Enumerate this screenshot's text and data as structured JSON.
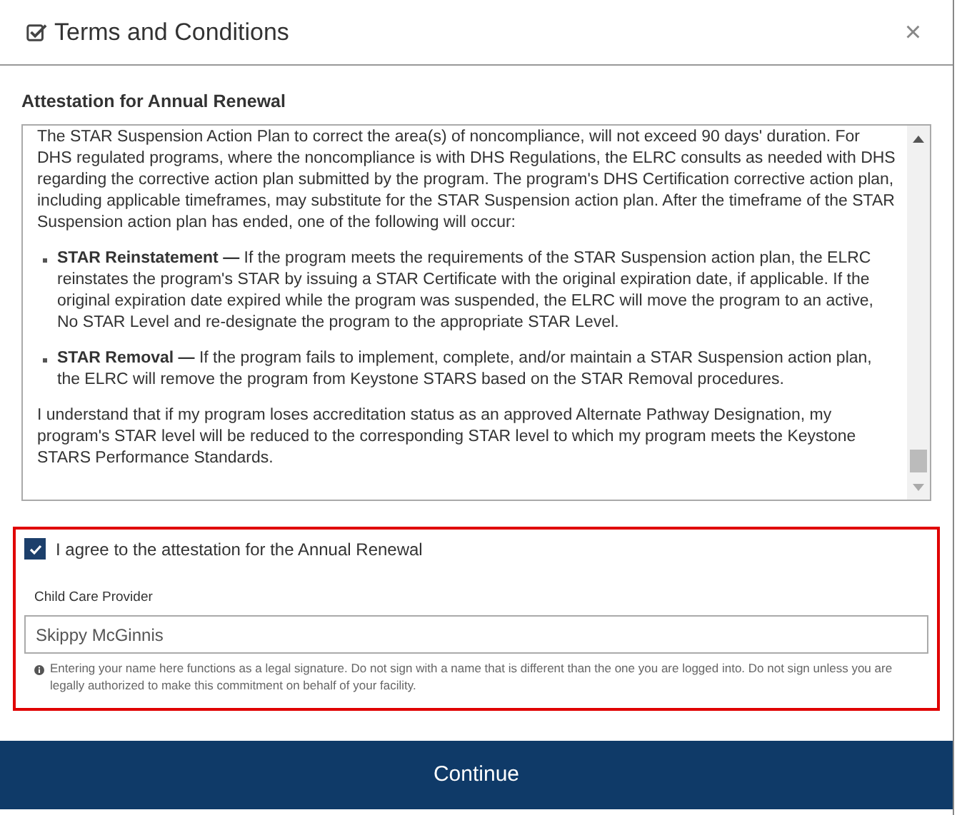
{
  "dialog": {
    "title": "Terms and Conditions",
    "close_label": "×"
  },
  "section_title": "Attestation for Annual Renewal",
  "terms": {
    "paragraphs": [
      {
        "kind": "text",
        "text": "The STAR Suspension Action Plan to correct the area(s) of noncompliance, will not exceed 90 days' duration. For DHS regulated programs, where the noncompliance is with DHS Regulations, the ELRC consults as needed with DHS regarding the corrective action plan submitted by the program. The program's DHS Certification corrective action plan, including applicable timeframes, may substitute for the STAR Suspension action plan. After the timeframe of the STAR Suspension action plan has ended, one of the following will occur:"
      },
      {
        "kind": "bullets",
        "items": [
          "**STAR Reinstatement —** If the program meets the requirements of the STAR Suspension action plan, the ELRC reinstates the program's STAR by issuing a STAR Certificate with the original expiration date, if applicable. If the original expiration date expired while the program was suspended, the ELRC will move the program to an active, No STAR Level and re-designate the program to the appropriate STAR Level.",
          "**STAR Removal —** If the program fails to implement, complete, and/or maintain a STAR Suspension action plan, the ELRC will remove the program from Keystone STARS based on the STAR Removal procedures."
        ]
      },
      {
        "kind": "text",
        "text": "I understand that if my program loses accreditation status as an approved Alternate Pathway Designation, my program's STAR level will be reduced to the corresponding STAR level to which my program meets the Keystone STARS Performance Standards."
      }
    ]
  },
  "agreement": {
    "label": "I agree to the attestation for the Annual Renewal",
    "checked": true,
    "highlighted": true
  },
  "signature": {
    "label": "Child Care Provider",
    "value": "Skippy McGinnis",
    "note": "Entering your name here functions as a legal signature. Do not sign with a name that is different than the one you are logged into. Do not sign unless you are legally authorized to make this commitment on behalf of your facility."
  },
  "continue_button": "Continue"
}
